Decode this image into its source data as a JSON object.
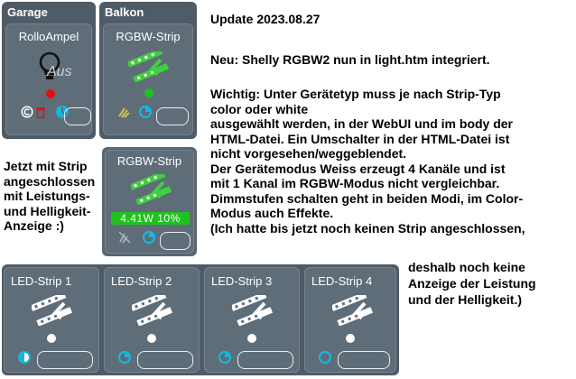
{
  "groups": {
    "garage": {
      "header": "Garage",
      "tile_title": "RolloAmpel",
      "lamp_status": "Aus"
    },
    "balkon": {
      "header": "Balkon",
      "tile_title": "RGBW-Strip"
    }
  },
  "side_note": [
    "Jetzt mit Strip",
    "angeschlossen",
    "mit Leistungs-",
    "und Helligkeit-",
    "Anzeige :)"
  ],
  "rgbw_tile": {
    "title": "RGBW-Strip",
    "readout": "4.41W 10%"
  },
  "led_tiles": [
    {
      "title": "LED-Strip 1"
    },
    {
      "title": "LED-Strip 2"
    },
    {
      "title": "LED-Strip 3"
    },
    {
      "title": "LED-Strip 4"
    }
  ],
  "notes": {
    "update": "Update 2023.08.27",
    "neu": "Neu:  Shelly RGBW2 nun in light.htm integriert.",
    "wichtig": [
      "Wichtig: Unter Gerätetyp muss je nach Strip-Typ",
      "color oder white",
      "ausgewählt werden, in der WebUI und im body der",
      "HTML-Datei. Ein Umschalter in der HTML-Datei ist",
      "nicht vorgesehen/weggeblendet.",
      "Der Gerätemodus Weiss erzeugt 4 Kanäle und ist",
      "mit 1 Kanal im RGBW-Modus nicht vergleichbar.",
      "Dimmstufen schalten geht in beiden Modi, im Color-",
      "Modus auch Effekte.",
      "(Ich hatte bis jetzt noch keinen Strip angeschlossen,"
    ],
    "tail": [
      "deshalb noch keine",
      "Anzeige der Leistung",
      "und der Helligkeit.)"
    ]
  },
  "colors": {
    "panel": "#4f5b66",
    "tile": "#5f6d79",
    "green": "#1fc11f",
    "red": "#e01010",
    "cyan": "#15b6e0",
    "strip": "#3fd03f"
  }
}
